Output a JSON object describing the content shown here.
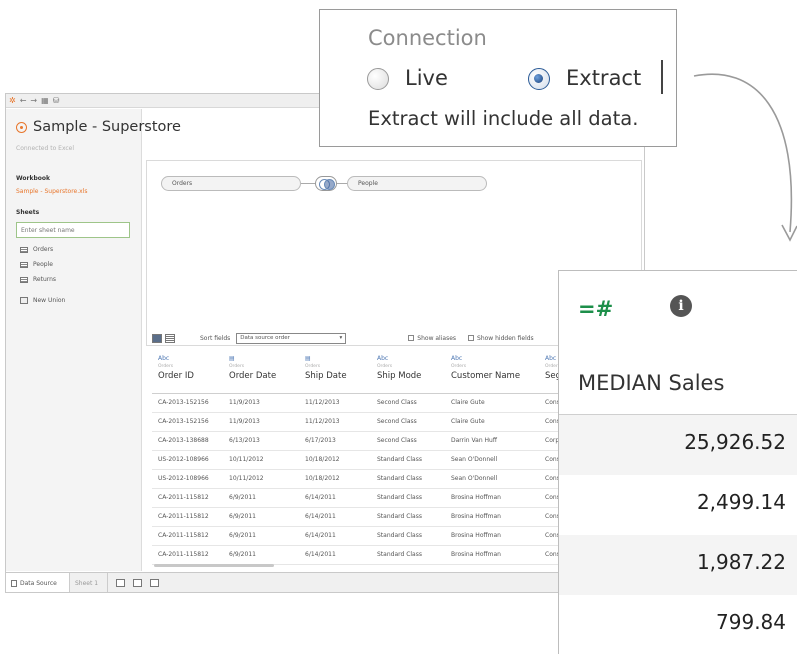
{
  "window": {
    "toolbar_icons": [
      "tableau-logo",
      "back",
      "forward",
      "save",
      "new-data-source"
    ],
    "data_source_title": "Sample - Superstore",
    "connected_text": "Connected to Excel"
  },
  "sidebar": {
    "workbook_label": "Workbook",
    "workbook_file": "Sample - Superstore.xls",
    "sheets_label": "Sheets",
    "sheet_search_placeholder": "Enter sheet name",
    "sheets": [
      "Orders",
      "People",
      "Returns"
    ],
    "new_union": "New Union"
  },
  "canvas": {
    "left_table": "Orders",
    "right_table": "People"
  },
  "grid_toolbar": {
    "sort_label": "Sort fields",
    "sort_value": "Data source order",
    "show_aliases": "Show aliases",
    "show_hidden": "Show hidden fields"
  },
  "grid": {
    "columns": [
      {
        "type": "Abc",
        "source": "Orders",
        "name": "Order ID"
      },
      {
        "type": "date",
        "source": "Orders",
        "name": "Order Date"
      },
      {
        "type": "date",
        "source": "Orders",
        "name": "Ship Date"
      },
      {
        "type": "Abc",
        "source": "Orders",
        "name": "Ship Mode"
      },
      {
        "type": "Abc",
        "source": "Orders",
        "name": "Customer Name"
      },
      {
        "type": "Abc",
        "source": "Orders",
        "name": "Segment"
      }
    ],
    "rows": [
      [
        "CA-2013-152156",
        "11/9/2013",
        "11/12/2013",
        "Second Class",
        "Claire Gute",
        "Consumer"
      ],
      [
        "CA-2013-152156",
        "11/9/2013",
        "11/12/2013",
        "Second Class",
        "Claire Gute",
        "Consumer"
      ],
      [
        "CA-2013-138688",
        "6/13/2013",
        "6/17/2013",
        "Second Class",
        "Darrin Van Huff",
        "Corporate"
      ],
      [
        "US-2012-108966",
        "10/11/2012",
        "10/18/2012",
        "Standard Class",
        "Sean O'Donnell",
        "Consumer"
      ],
      [
        "US-2012-108966",
        "10/11/2012",
        "10/18/2012",
        "Standard Class",
        "Sean O'Donnell",
        "Consumer"
      ],
      [
        "CA-2011-115812",
        "6/9/2011",
        "6/14/2011",
        "Standard Class",
        "Brosina Hoffman",
        "Consumer"
      ],
      [
        "CA-2011-115812",
        "6/9/2011",
        "6/14/2011",
        "Standard Class",
        "Brosina Hoffman",
        "Consumer"
      ],
      [
        "CA-2011-115812",
        "6/9/2011",
        "6/14/2011",
        "Standard Class",
        "Brosina Hoffman",
        "Consumer"
      ],
      [
        "CA-2011-115812",
        "6/9/2011",
        "6/14/2011",
        "Standard Class",
        "Brosina Hoffman",
        "Consumer"
      ]
    ]
  },
  "bottom_tabs": {
    "data_source": "Data Source",
    "sheet1": "Sheet 1"
  },
  "connection": {
    "title": "Connection",
    "live_label": "Live",
    "extract_label": "Extract",
    "selected": "Extract",
    "note": "Extract will include all data."
  },
  "sales_panel": {
    "type_icon": "number-icon",
    "info_icon": "info-icon",
    "header": "MEDIAN Sales",
    "values": [
      "25,926.52",
      "2,499.14",
      "1,987.22",
      "799.84"
    ]
  },
  "colors": {
    "accent_orange": "#e8762c",
    "selected_blue": "#2a5a96",
    "number_green": "#1d8f4a"
  }
}
